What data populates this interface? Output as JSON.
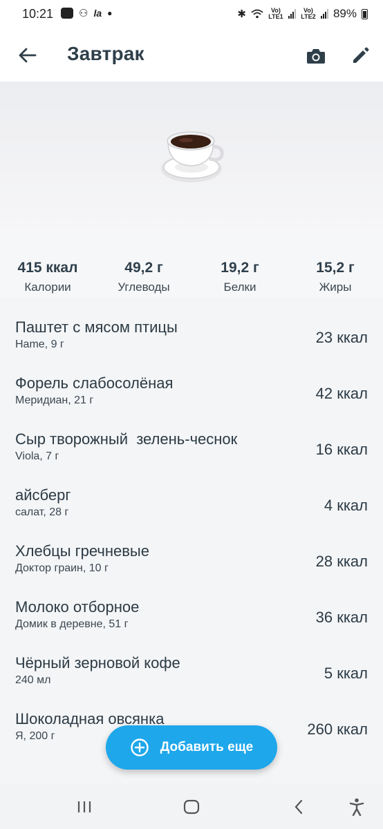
{
  "status_bar": {
    "time": "10:21",
    "app_icons": [
      "la"
    ],
    "network_1": "Vo) LTE1",
    "network_2": "Vo) LTE2",
    "battery": "89%"
  },
  "header": {
    "title": "Завтрак",
    "icons": [
      "back-arrow-icon",
      "camera-icon",
      "pencil-icon"
    ]
  },
  "hero": {
    "icon": "coffee-cup-icon"
  },
  "summary": [
    {
      "value": "415 ккал",
      "label": "Калории"
    },
    {
      "value": "49,2 г",
      "label": "Углеводы"
    },
    {
      "value": "19,2 г",
      "label": "Белки"
    },
    {
      "value": "15,2 г",
      "label": "Жиры"
    }
  ],
  "foods": [
    {
      "name": "Паштет с мясом птицы",
      "sub": "Hame, 9 г",
      "kcal": "23 ккал"
    },
    {
      "name": "Форель слабосолёная",
      "sub": "Меридиан, 21 г",
      "kcal": "42 ккал"
    },
    {
      "name": "Сыр творожный  зелень-чеснок",
      "sub": "Viola, 7 г",
      "kcal": "16 ккал"
    },
    {
      "name": "айсберг",
      "sub": "салат, 28 г",
      "kcal": "4 ккал"
    },
    {
      "name": "Хлебцы гречневые",
      "sub": "Доктор граин, 10 г",
      "kcal": "28 ккал"
    },
    {
      "name": "Молоко отборное",
      "sub": "Домик в деревне, 51 г",
      "kcal": "36 ккал"
    },
    {
      "name": "Чёрный зерновой кофе",
      "sub": "240 мл",
      "kcal": "5 ккал"
    },
    {
      "name": "Шоколадная овсянка",
      "sub": "Я, 200 г",
      "kcal": "260 ккал"
    }
  ],
  "fab": {
    "label": "Добавить еще",
    "icon": "plus-circle-icon"
  },
  "colors": {
    "accent": "#1ea7ea",
    "text": "#2b3a44",
    "background": "#f4f5f7"
  },
  "nav_bar": {
    "icons": [
      "recent-apps-icon",
      "home-icon",
      "back-icon",
      "accessibility-icon"
    ]
  }
}
